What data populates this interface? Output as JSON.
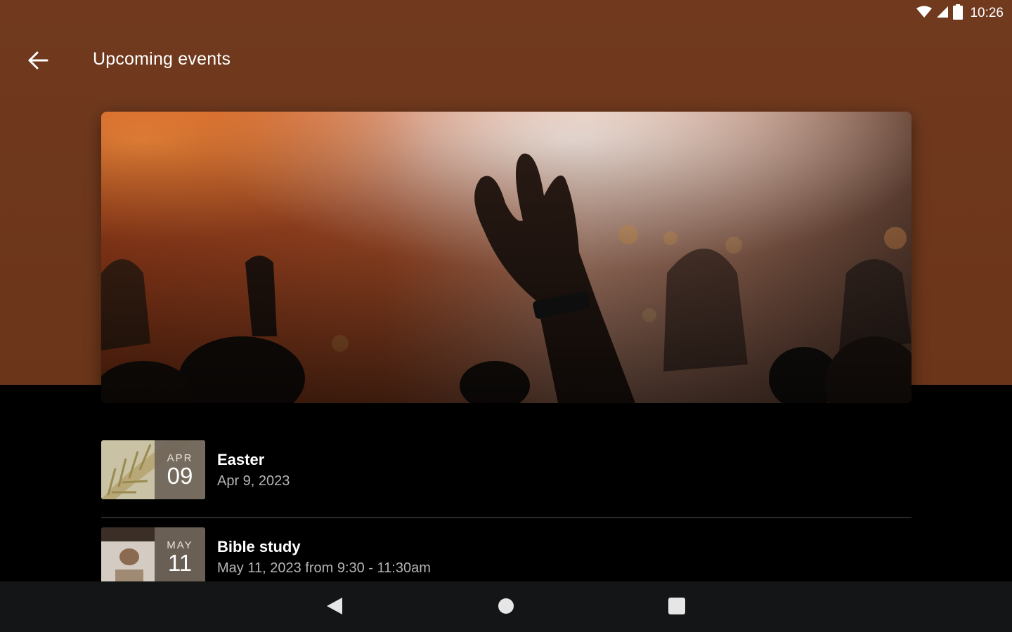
{
  "status_bar": {
    "time": "10:26",
    "icons": [
      "wifi-icon",
      "cellular-signal-icon",
      "battery-icon"
    ]
  },
  "app_bar": {
    "title": "Upcoming events",
    "back_icon": "arrow-left-icon"
  },
  "hero": {
    "image": "worship-concert-photo"
  },
  "events": [
    {
      "title": "Easter",
      "subtitle": "Apr 9, 2023",
      "month": "APR",
      "day": "09",
      "thumb": "palm-leaf-photo"
    },
    {
      "title": "Bible study",
      "subtitle": "May 11, 2023 from 9:30 - 11:30am",
      "month": "MAY",
      "day": "11",
      "thumb": "bible-study-photo"
    }
  ],
  "nav_bar": {
    "back_icon": "triangle-back-icon",
    "home_icon": "circle-home-icon",
    "recents_icon": "square-recents-icon"
  },
  "colors": {
    "header_bg": "#713a1f",
    "body_bg": "#000000",
    "nav_bg": "#141516"
  }
}
